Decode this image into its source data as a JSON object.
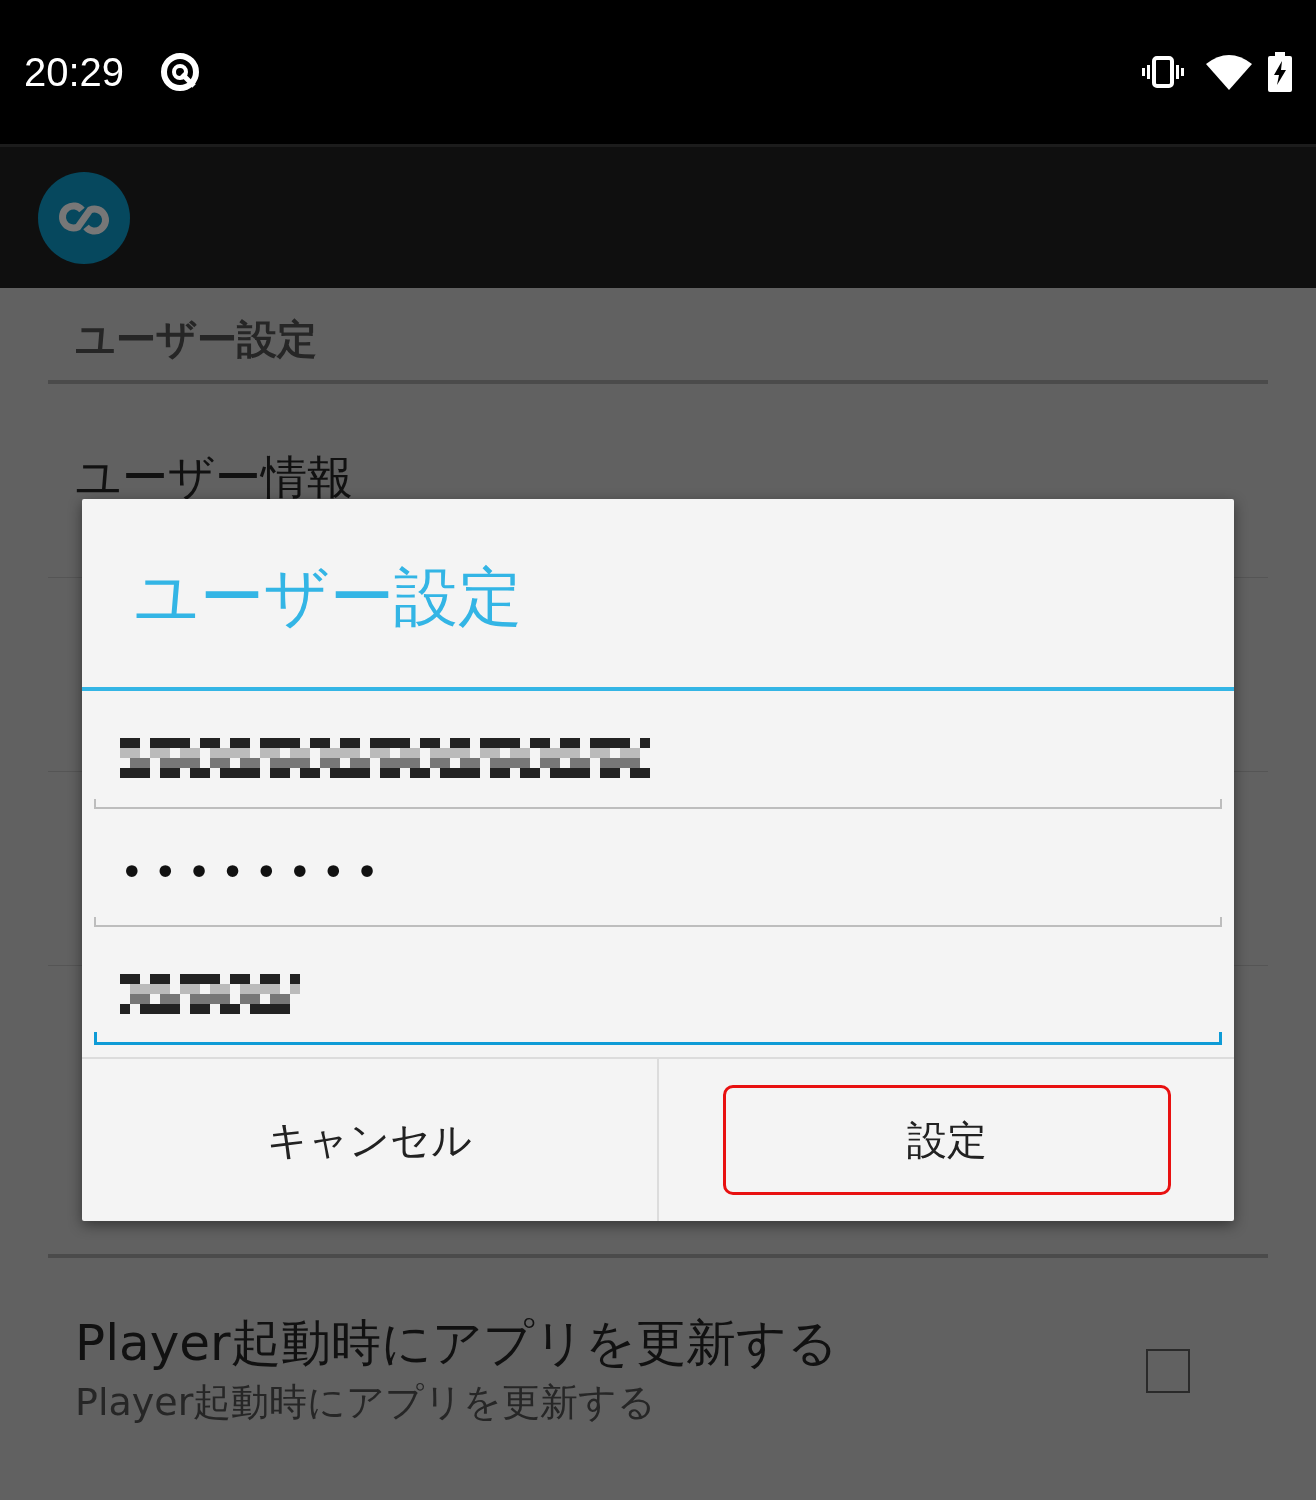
{
  "status_bar": {
    "time": "20:29"
  },
  "settings": [
    {
      "kind": "header",
      "label": "ユーザー設定"
    },
    {
      "kind": "item",
      "title": "ユーザー情報"
    },
    {
      "kind": "checkbox",
      "title": "Player起動時にアプリを更新する",
      "summary": "Player起動時にアプリを更新する",
      "checked": false
    }
  ],
  "dialog": {
    "title": "ユーザー設定",
    "fields": [
      {
        "kind": "redacted",
        "focused": false
      },
      {
        "kind": "password",
        "value": "••••••••",
        "focused": false
      },
      {
        "kind": "redacted",
        "focused": true
      }
    ],
    "buttons": [
      {
        "label": "キャンセル",
        "highlighted": false
      },
      {
        "label": "設定",
        "highlighted": true
      }
    ]
  }
}
